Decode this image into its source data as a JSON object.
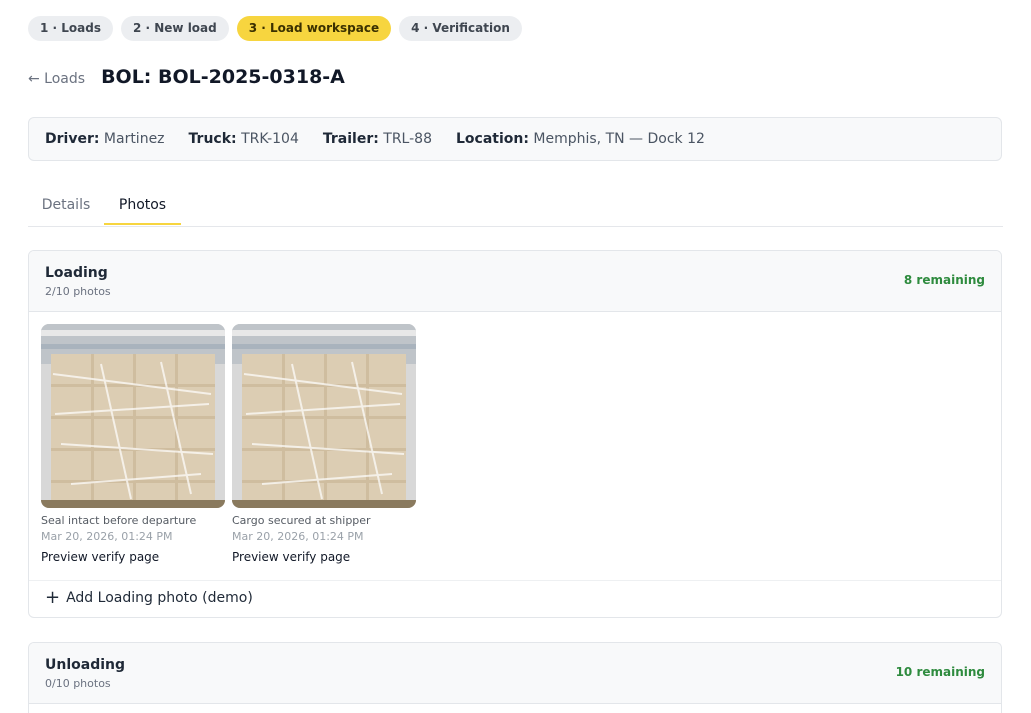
{
  "steps": [
    {
      "label": "1 · Loads"
    },
    {
      "label": "2 · New load"
    },
    {
      "label": "3 · Load workspace"
    },
    {
      "label": "4 · Verification"
    }
  ],
  "header": {
    "back_label": "← Loads",
    "title": "BOL: BOL-2025-0318-A"
  },
  "info": {
    "driver_label": "Driver:",
    "driver": "Martinez",
    "truck_label": "Truck:",
    "truck": "TRK-104",
    "trailer_label": "Trailer:",
    "trailer": "TRL-88",
    "location_label": "Location:",
    "location": "Memphis, TN — Dock 12"
  },
  "tabs": [
    {
      "label": "Details"
    },
    {
      "label": "Photos"
    }
  ],
  "loading": {
    "title": "Loading",
    "count": "2/10 photos",
    "remaining": "8 remaining",
    "photos": [
      {
        "caption": "Seal intact before departure",
        "timestamp": "Mar 20, 2026, 01:24 PM",
        "preview": "Preview verify page"
      },
      {
        "caption": "Cargo secured at shipper",
        "timestamp": "Mar 20, 2026, 01:24 PM",
        "preview": "Preview verify page"
      }
    ],
    "add_label": "Add Loading photo (demo)"
  },
  "unloading": {
    "title": "Unloading",
    "count": "0/10 photos",
    "remaining": "10 remaining"
  },
  "colors": {
    "accent": "#f7d53f",
    "remaining": "#2e8b3e"
  }
}
